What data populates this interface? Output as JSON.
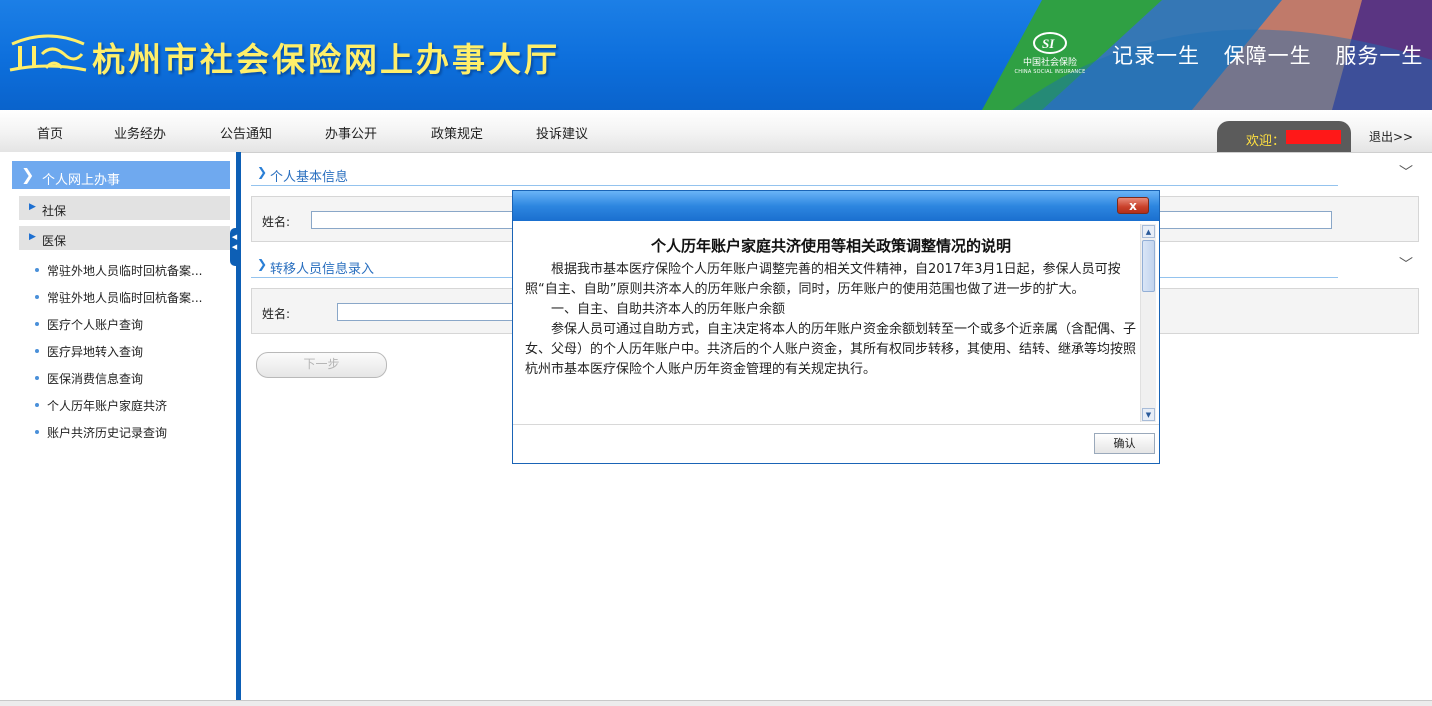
{
  "banner": {
    "site_title": "杭州市社会保险网上办事大厅",
    "si_logo_text": "中国社会保险",
    "si_logo_sub": "CHINA SOCIAL INSURANCE",
    "slogans": [
      "记录一生",
      "保障一生",
      "服务一生"
    ]
  },
  "nav": {
    "items": [
      "首页",
      "业务经办",
      "公告通知",
      "办事公开",
      "政策规定",
      "投诉建议"
    ],
    "welcome": "欢迎：",
    "logout": "退出>>"
  },
  "sidebar": {
    "header": "个人网上办事",
    "categories": [
      "社保",
      "医保"
    ],
    "links": [
      "常驻外地人员临时回杭备案...",
      "常驻外地人员临时回杭备案...",
      "医疗个人账户查询",
      "医疗异地转入查询",
      "医保消费信息查询",
      "个人历年账户家庭共济",
      "账户共济历史记录查询"
    ]
  },
  "main": {
    "section1_title": "个人基本信息",
    "section1_name_label": "姓名:",
    "section2_title": "转移人员信息录入",
    "section2_name_label": "姓名:",
    "next_button": "下一步"
  },
  "dialog": {
    "close_label": "x",
    "doc_title": "个人历年账户家庭共济使用等相关政策调整情况的说明",
    "paragraphs": [
      "根据我市基本医疗保险个人历年账户调整完善的相关文件精神，自2017年3月1日起，参保人员可按照“自主、自助”原则共济本人的历年账户余额，同时，历年账户的使用范围也做了进一步的扩大。",
      "一、自主、自助共济本人的历年账户余额",
      "参保人员可通过自助方式，自主决定将本人的历年账户资金余额划转至一个或多个近亲属（含配偶、子女、父母）的个人历年账户中。共济后的个人账户资金，其所有权同步转移，其使用、结转、继承等均按照杭州市基本医疗保险个人账户历年资金管理的有关规定执行。"
    ],
    "confirm_button": "确认"
  },
  "colors": {
    "banner_blue": "#0d6fdc",
    "title_yellow": "#ffef6a",
    "divider_blue": "#0d5fb5",
    "redaction": "#ff1818"
  }
}
